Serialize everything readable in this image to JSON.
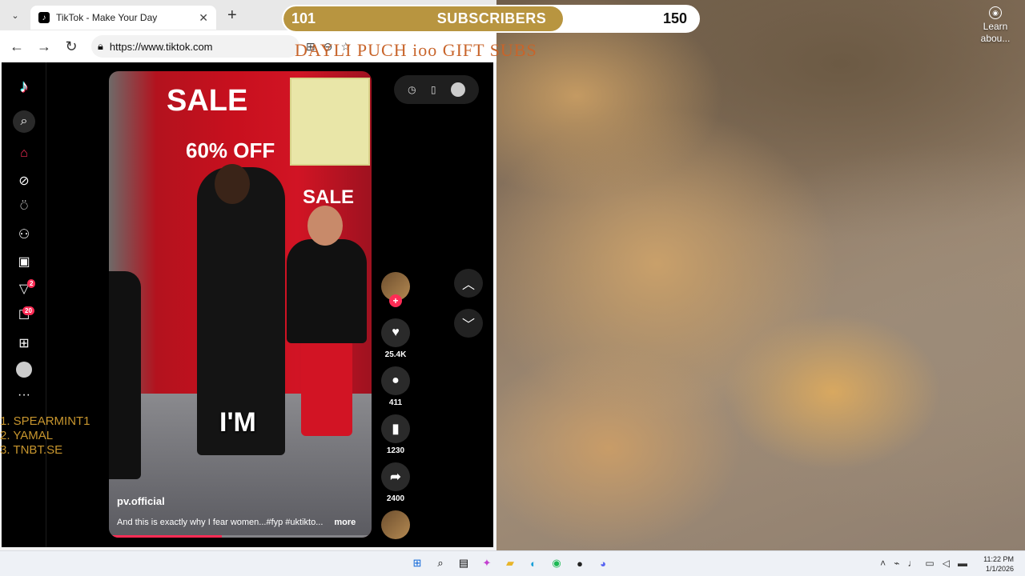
{
  "browser": {
    "tab_title": "TikTok - Make Your Day",
    "tab_close": "✕",
    "new_tab": "+",
    "url": "https://www.tiktok.com"
  },
  "desktop": {
    "learn_about": "Learn abou..."
  },
  "stream": {
    "subscribers_current": "101",
    "subscribers_label": "SUBSCRIBERS",
    "subscribers_goal": "150",
    "subscribers_progress": 0.673,
    "dayli_text": "DAYLI PUCH ioo GIFT SUBS",
    "leaderboard": [
      "1.  SPEARMINT1",
      "2.  YAMAL",
      "3.  TNBT.SE"
    ]
  },
  "tiktok": {
    "sidebar_badges": {
      "inbox": "2",
      "messages": "20"
    },
    "video": {
      "username": "pv.official",
      "description": "And this is exactly why I fear women...#fyp #uktikto...",
      "more": "more",
      "overlay_caption": "I'M",
      "sign_sale1": "SALE",
      "sign_60": "60% OFF",
      "sign_sale2": "SALE",
      "progress": 0.43
    },
    "actions": {
      "likes": "25.4K",
      "comments": "411",
      "saves": "1230",
      "shares": "2400"
    }
  },
  "taskbar": {
    "time": "11:22 PM",
    "date": "1/1/2026"
  }
}
